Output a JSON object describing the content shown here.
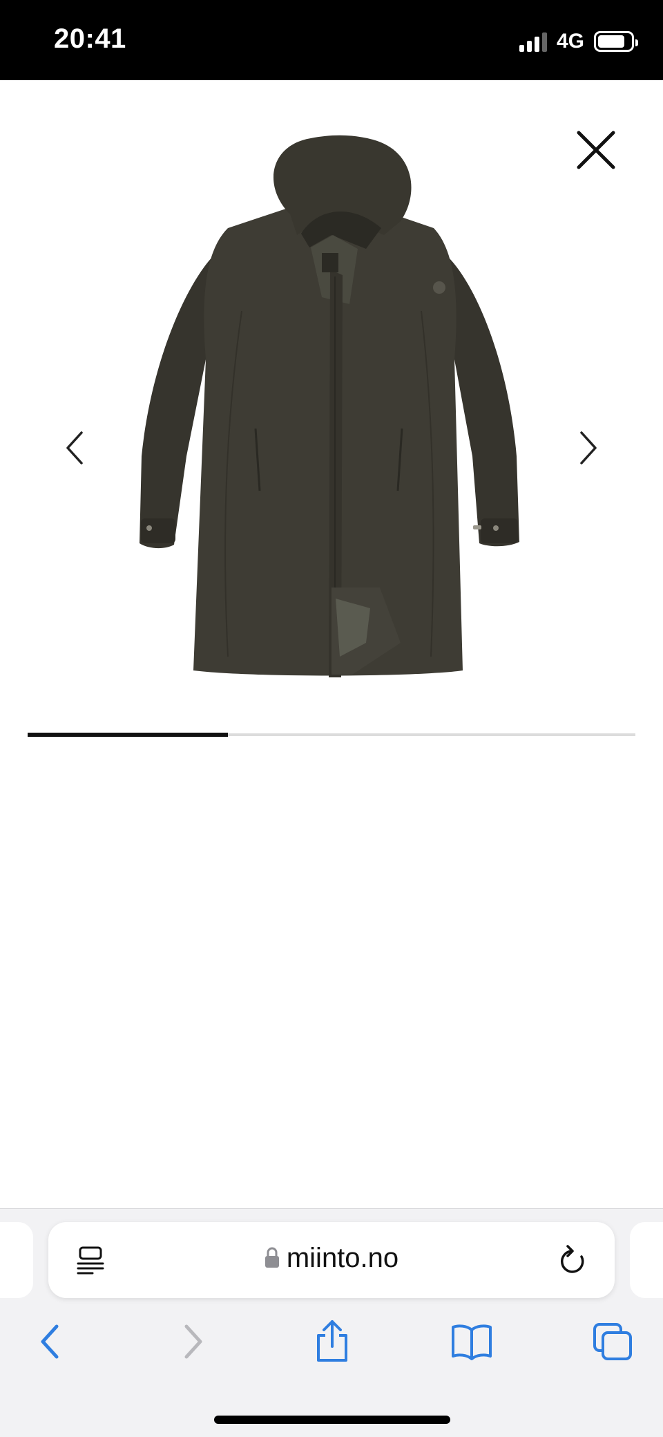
{
  "status_bar": {
    "time": "20:41",
    "network": "4G",
    "signal_bars_active": 3,
    "battery_level": 0.75
  },
  "gallery": {
    "product_image": "dark olive hooded long coat",
    "image_index": 1,
    "image_count": 3,
    "progress": 0.33,
    "close_icon": "close-icon",
    "prev_icon": "chevron-left-icon",
    "next_icon": "chevron-right-icon"
  },
  "browser": {
    "url": "miinto.no",
    "reader_icon": "reader-mode-icon",
    "lock_icon": "lock-icon",
    "reload_icon": "reload-icon",
    "toolbar": [
      "back-icon",
      "forward-icon",
      "share-icon",
      "bookmarks-icon",
      "tabs-icon"
    ],
    "accent_color": "#2f7ee0",
    "disabled_color": "#b8b8bc"
  },
  "colors": {
    "coat": "#3e3c34",
    "status_bar_bg": "#000000"
  }
}
